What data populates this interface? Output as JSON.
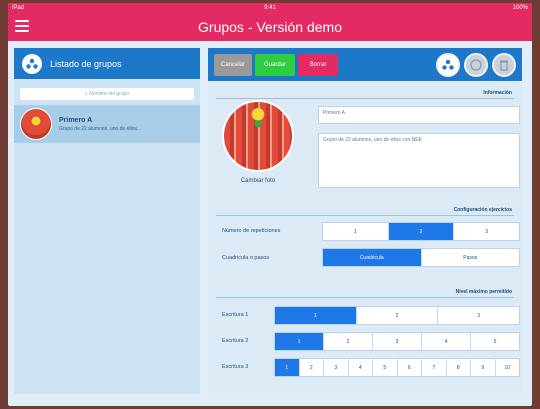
{
  "status": {
    "left": "iPad",
    "time": "9:41",
    "battery": "100%"
  },
  "app": {
    "title": "Grupos - Versión demo"
  },
  "left": {
    "header": "Listado de grupos",
    "search_placeholder": "Nombre del grupo",
    "groups": [
      {
        "name": "Primero A",
        "description": "Grupo de 22 alumnos, uno de ellos..."
      }
    ]
  },
  "toolbar": {
    "cancel": "Cancelar",
    "save": "Guardar",
    "delete": "Borrar",
    "icons": [
      "team-icon",
      "ball-icon",
      "trash-icon"
    ]
  },
  "info": {
    "section": "Información",
    "photo_label": "Cambiar foto",
    "name_value": "Primero A",
    "description_value": "Grupo de 22 alumnos, uno de ellos con NEE"
  },
  "config": {
    "section": "Configuración ejercicios",
    "reps_label": "Número de repeticiones",
    "reps_options": [
      "1",
      "2",
      "3"
    ],
    "reps_selected": 1,
    "replace_label": "Cuadricula o pasos",
    "replace_options": [
      "Cuadricula",
      "Pasos"
    ],
    "replace_selected": 0
  },
  "levels": {
    "section": "Nivel máximo permitido",
    "rows": [
      {
        "label": "Escritura 1",
        "options": [
          "1",
          "2",
          "3"
        ],
        "selected": 0
      },
      {
        "label": "Escritura 2",
        "options": [
          "1",
          "2",
          "3",
          "4",
          "5"
        ],
        "selected": 0
      },
      {
        "label": "Escritura 3",
        "options": [
          "1",
          "2",
          "3",
          "4",
          "5",
          "6",
          "7",
          "8",
          "9",
          "10"
        ],
        "selected": 0
      }
    ]
  },
  "colors": {
    "accent_pink": "#e32a63",
    "header_blue": "#1e78c8",
    "selected_blue": "#1e78e8",
    "save_green": "#2ecc40",
    "cancel_gray": "#9a9a9a"
  }
}
